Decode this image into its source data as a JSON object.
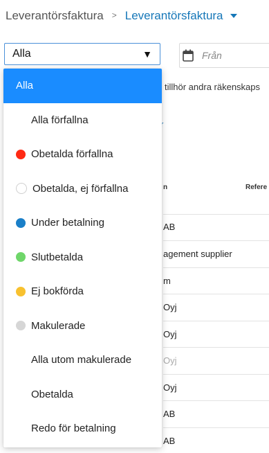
{
  "breadcrumb": {
    "root": "Leverantörsfaktura",
    "separator": ">",
    "current": "Leverantörsfaktura"
  },
  "filter": {
    "selected": "Alla",
    "arrow": "▼",
    "date_from_placeholder": "Från"
  },
  "background": {
    "notice_fragment": "tillhör andra räkenskaps",
    "link_fragment": "r",
    "columns": {
      "name_fragment": "n",
      "reference": "Refere"
    },
    "rows": [
      "AB",
      "agement supplier",
      "m",
      "Oyj",
      "Oyj",
      "Oyj",
      "Oyj",
      "AB",
      "AB"
    ]
  },
  "dropdown": {
    "options": [
      {
        "label": "Alla",
        "dot": null,
        "active": true
      },
      {
        "label": "Alla förfallna",
        "dot": null
      },
      {
        "label": "Obetalda förfallna",
        "dot": "#ff2a14"
      },
      {
        "label": "Obetalda, ej förfallna",
        "dot": "outline"
      },
      {
        "label": "Under betalning",
        "dot": "#1a7fc8"
      },
      {
        "label": "Slutbetalda",
        "dot": "#6fd66a"
      },
      {
        "label": "Ej bokförda",
        "dot": "#f8c12f"
      },
      {
        "label": "Makulerade",
        "dot": "#d6d6d6"
      },
      {
        "label": "Alla utom makulerade",
        "dot": null
      },
      {
        "label": "Obetalda",
        "dot": null
      },
      {
        "label": "Redo för betalning",
        "dot": null
      }
    ]
  },
  "colors": {
    "accent": "#1677b8",
    "active_bg": "#1a8cff"
  }
}
